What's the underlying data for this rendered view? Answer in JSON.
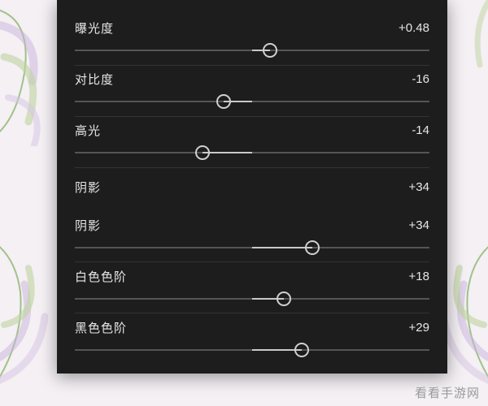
{
  "panel": {
    "sliders": [
      {
        "id": "exposure",
        "label": "曝光度",
        "value_display": "+0.48"
      },
      {
        "id": "contrast",
        "label": "对比度",
        "value_display": "-16"
      },
      {
        "id": "highlights",
        "label": "高光",
        "value_display": "-14"
      },
      {
        "id": "shadows",
        "label": "阴影",
        "value_display": "+34"
      },
      {
        "id": "shadows2",
        "label": "阴影",
        "value_display": "+34"
      },
      {
        "id": "whites",
        "label": "白色色阶",
        "value_display": "+18"
      },
      {
        "id": "blacks",
        "label": "黑色色阶",
        "value_display": "+29"
      }
    ]
  },
  "watermark": "看看手游网",
  "icons": {
    "slider_thumb": "circle-outline-icon"
  },
  "colors": {
    "panel_bg": "#1d1d1d",
    "track": "#555555",
    "fill": "#c9c9c9",
    "text": "#e6e6e6",
    "page_bg": "#f4f0f4",
    "divider": "#333333"
  }
}
